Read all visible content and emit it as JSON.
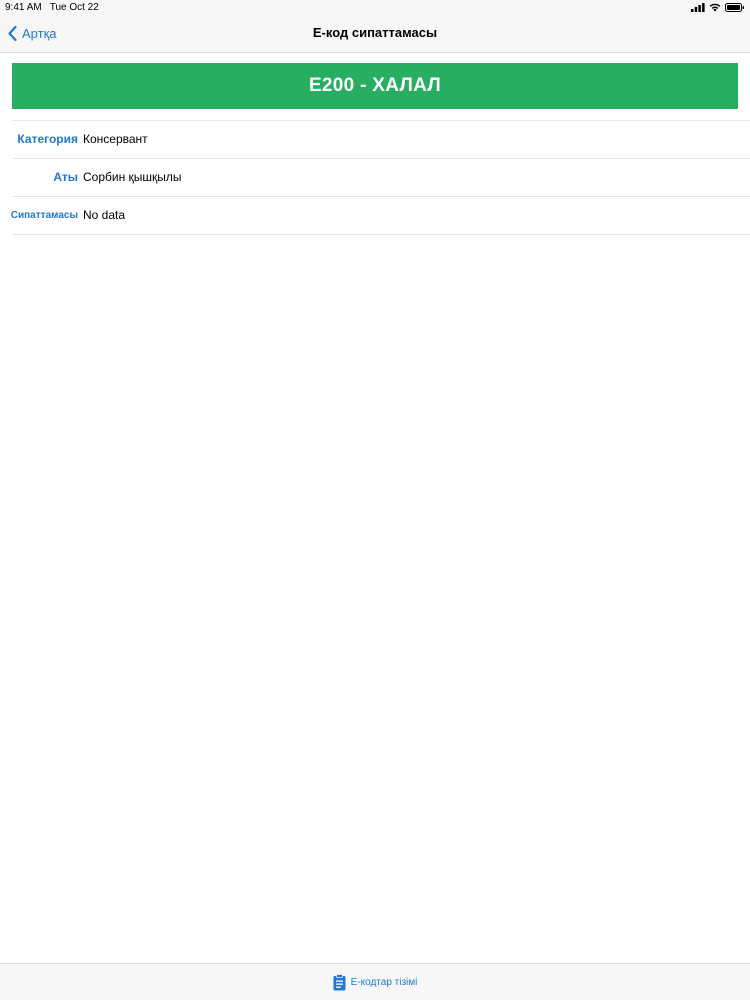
{
  "status_bar": {
    "time": "9:41 AM",
    "date": "Tue Oct 22"
  },
  "nav": {
    "back_label": "Артқа",
    "title": "Е-код сипаттамасы"
  },
  "banner": {
    "text": "E200 - ХАЛАЛ",
    "color": "#27ae60"
  },
  "details": [
    {
      "label": "Категория",
      "value": "Консервант"
    },
    {
      "label": "Аты",
      "value": "Сорбин қышқылы"
    },
    {
      "label": "Сипаттамасы",
      "value": "No data"
    }
  ],
  "tab_bar": {
    "item_label": "Е-кодтар тізімі",
    "icon": "clipboard-list-icon"
  },
  "accent_color": "#1f78d1"
}
